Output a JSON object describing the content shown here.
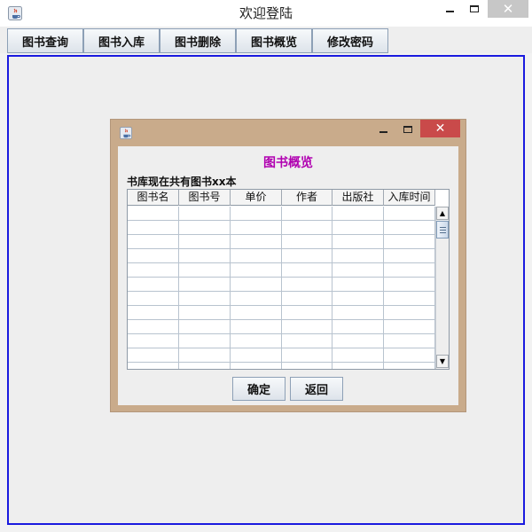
{
  "window": {
    "title": "欢迎登陆",
    "close_glyph": "✕"
  },
  "menu_tabs": [
    {
      "label": "图书查询"
    },
    {
      "label": "图书入库"
    },
    {
      "label": "图书删除"
    },
    {
      "label": "图书概览"
    },
    {
      "label": "修改密码"
    }
  ],
  "overview_frame": {
    "close_glyph": "✕",
    "heading": "图书概览",
    "heading_color": "#b000b0",
    "count_text": "书库现在共有图书xx本",
    "table": {
      "columns": [
        "图书名",
        "图书号",
        "单价",
        "作者",
        "出版社",
        "入库时间"
      ],
      "rows": [
        [
          "",
          "",
          "",
          "",
          "",
          ""
        ],
        [
          "",
          "",
          "",
          "",
          "",
          ""
        ],
        [
          "",
          "",
          "",
          "",
          "",
          ""
        ],
        [
          "",
          "",
          "",
          "",
          "",
          ""
        ],
        [
          "",
          "",
          "",
          "",
          "",
          ""
        ],
        [
          "",
          "",
          "",
          "",
          "",
          ""
        ],
        [
          "",
          "",
          "",
          "",
          "",
          ""
        ],
        [
          "",
          "",
          "",
          "",
          "",
          ""
        ],
        [
          "",
          "",
          "",
          "",
          "",
          ""
        ],
        [
          "",
          "",
          "",
          "",
          "",
          ""
        ],
        [
          "",
          "",
          "",
          "",
          "",
          ""
        ],
        [
          "",
          "",
          "",
          "",
          "",
          ""
        ]
      ]
    },
    "scroll_up_glyph": "▲",
    "scroll_down_glyph": "▼",
    "buttons": {
      "confirm": "确定",
      "back": "返回"
    }
  },
  "colors": {
    "desktop_border": "#1a1adf",
    "frame_border": "#c9ab8b",
    "close_red": "#c94a4a"
  },
  "icons": [
    "java-app-icon",
    "minimize-icon",
    "maximize-icon",
    "close-icon"
  ]
}
